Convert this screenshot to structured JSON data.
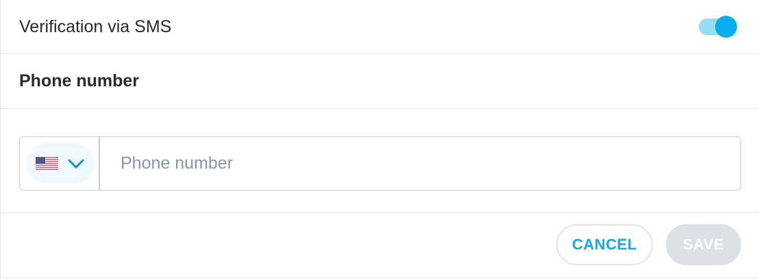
{
  "sms_verification": {
    "label": "Verification via SMS",
    "toggle_on": true,
    "toggle_color": "#08adf0"
  },
  "phone_section": {
    "title": "Phone number",
    "country": {
      "flag_icon": "us-flag-icon",
      "dropdown_icon": "chevron-down-icon"
    },
    "input": {
      "value": "",
      "placeholder": "Phone number"
    }
  },
  "actions": {
    "cancel_label": "CANCEL",
    "save_label": "SAVE",
    "save_enabled": false
  }
}
